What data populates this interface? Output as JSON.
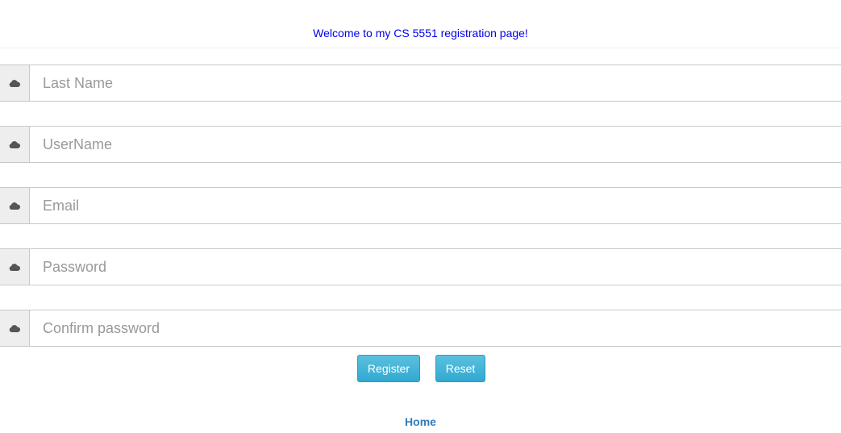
{
  "header": {
    "welcome_text": "Welcome to my CS 5551 registration page!"
  },
  "form": {
    "fields": [
      {
        "placeholder": "Last Name",
        "value": "",
        "icon": "cloud-icon"
      },
      {
        "placeholder": "UserName",
        "value": "",
        "icon": "cloud-icon"
      },
      {
        "placeholder": "Email",
        "value": "",
        "icon": "cloud-icon"
      },
      {
        "placeholder": "Password",
        "value": "",
        "icon": "cloud-icon"
      },
      {
        "placeholder": "Confirm password",
        "value": "",
        "icon": "cloud-icon"
      }
    ],
    "register_label": "Register",
    "reset_label": "Reset"
  },
  "footer": {
    "home_label": "Home"
  },
  "colors": {
    "welcome_text": "#0000ee",
    "button_bg": "#31a9d2",
    "link": "#337ab7"
  }
}
